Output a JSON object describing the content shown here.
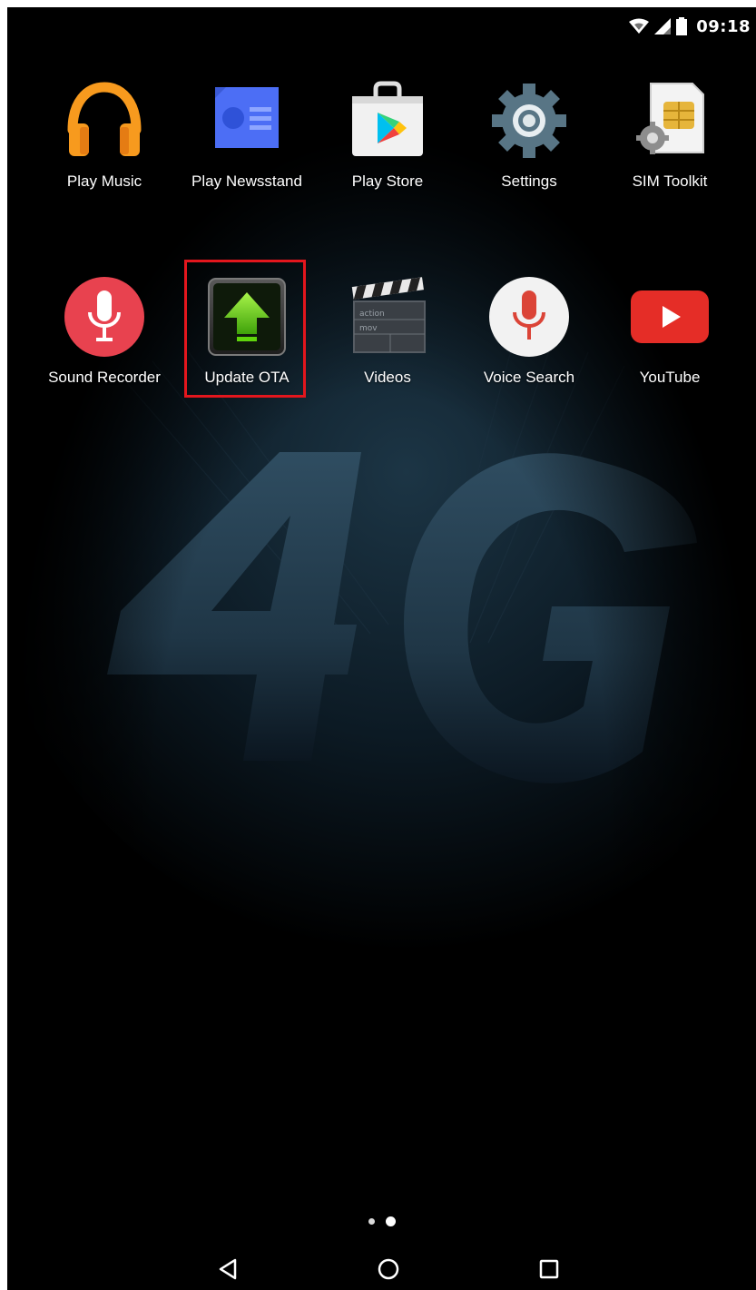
{
  "status_bar": {
    "time": "09:18",
    "icons": [
      "wifi-icon",
      "cell-signal-icon",
      "battery-icon"
    ]
  },
  "wallpaper": {
    "text": "4G"
  },
  "apps": [
    {
      "label": "Play Music",
      "icon": "play-music-icon"
    },
    {
      "label": "Play Newsstand",
      "icon": "play-newsstand-icon"
    },
    {
      "label": "Play Store",
      "icon": "play-store-icon"
    },
    {
      "label": "Settings",
      "icon": "settings-gear-icon"
    },
    {
      "label": "SIM Toolkit",
      "icon": "sim-toolkit-icon"
    },
    {
      "label": "Sound Recorder",
      "icon": "sound-recorder-mic-icon"
    },
    {
      "label": "Update OTA",
      "icon": "update-ota-arrow-icon",
      "highlighted": true
    },
    {
      "label": "Videos",
      "icon": "videos-clapperboard-icon",
      "clapper_lines": [
        "action",
        "mov"
      ]
    },
    {
      "label": "Voice Search",
      "icon": "voice-search-mic-icon"
    },
    {
      "label": "YouTube",
      "icon": "youtube-icon"
    }
  ],
  "pager": {
    "page_count": 2,
    "current_page": 2
  },
  "nav": {
    "back": "back-icon",
    "home": "home-icon",
    "recents": "recents-icon"
  },
  "colors": {
    "highlight": "#e3161d",
    "play_music_orange": "#f79a1e",
    "newsstand_blue": "#4c6ef5",
    "youtube_red": "#e52d27",
    "recorder_red": "#e8424f",
    "ota_green": "#6bd20c"
  }
}
